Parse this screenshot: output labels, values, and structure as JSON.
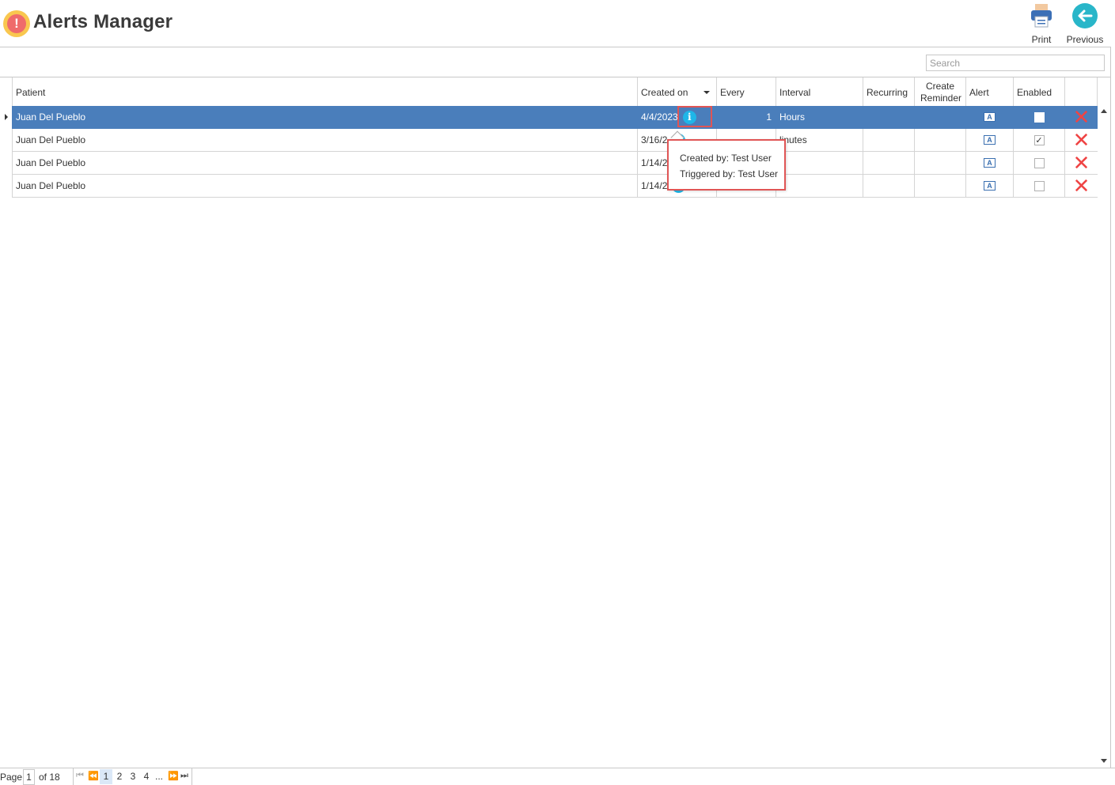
{
  "app": {
    "title": "Alerts Manager",
    "logo_glyph": "!"
  },
  "toolbar": {
    "print_label": "Print",
    "previous_label": "Previous"
  },
  "search": {
    "placeholder": "Search"
  },
  "columns": {
    "patient": "Patient",
    "created_on": "Created on",
    "every": "Every",
    "interval": "Interval",
    "recurring": "Recurring",
    "create_reminder": "Create Reminder",
    "alert": "Alert",
    "enabled": "Enabled"
  },
  "rows": [
    {
      "patient": "Juan Del Pueblo",
      "created_on": "4/4/2023",
      "every": "1",
      "interval": "Hours",
      "recurring": "",
      "enabled": false,
      "selected": true
    },
    {
      "patient": "Juan Del Pueblo",
      "created_on": "3/16/2",
      "every": "",
      "interval": "linutes",
      "recurring": "",
      "enabled": true,
      "selected": false
    },
    {
      "patient": "Juan Del Pueblo",
      "created_on": "1/14/2",
      "every": "",
      "interval": "",
      "recurring": "",
      "enabled": false,
      "selected": false
    },
    {
      "patient": "Juan Del Pueblo",
      "created_on": "1/14/2",
      "every": "",
      "interval": "",
      "recurring": "",
      "enabled": false,
      "selected": false
    }
  ],
  "tooltip": {
    "created_by": "Created by: Test User",
    "triggered_by": "Triggered by: Test User"
  },
  "pager": {
    "page_label": "Page",
    "current_page": "1",
    "of_label": "of 18",
    "first": "⏮",
    "prev": "⏪",
    "pages": [
      "1",
      "2",
      "3",
      "4"
    ],
    "ellipsis": "...",
    "next": "⏩",
    "last": "⏭"
  },
  "icons": {
    "info": "i",
    "alert": "A",
    "check": "✓",
    "delete": "✕"
  },
  "colors": {
    "selection": "#4a7ebb",
    "info": "#1fb6e8",
    "delete": "#ef4444",
    "highlight": "#e05555"
  }
}
